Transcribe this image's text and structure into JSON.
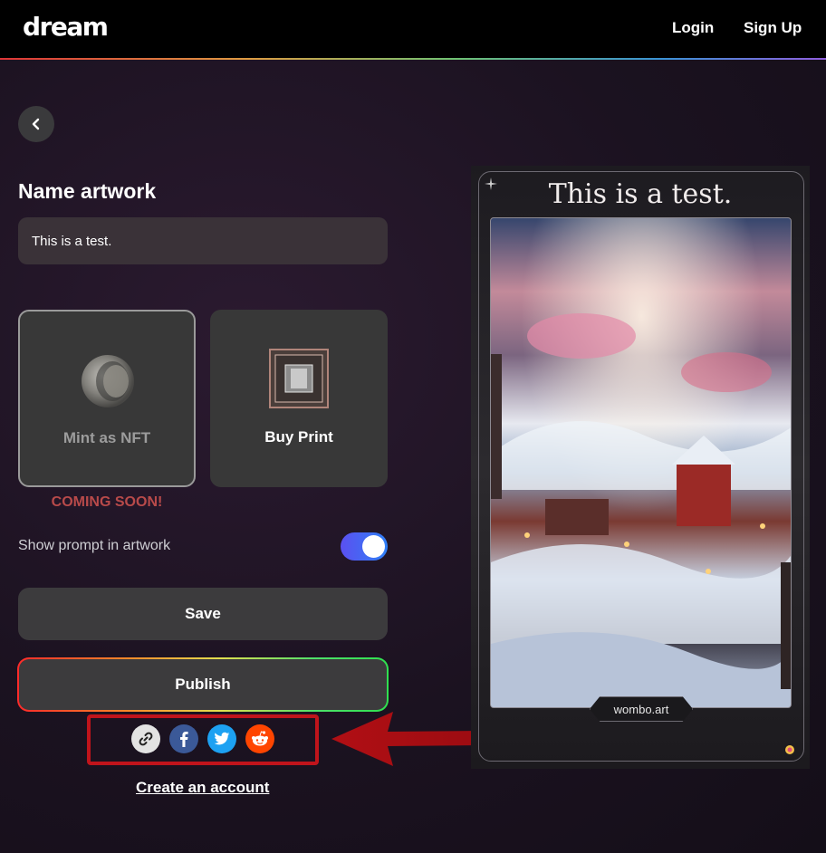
{
  "header": {
    "logo": "dream",
    "login_label": "Login",
    "signup_label": "Sign Up"
  },
  "form": {
    "title": "Name artwork",
    "name_value": "This is a test.",
    "options": [
      {
        "label": "Mint as NFT",
        "status": "COMING SOON!"
      },
      {
        "label": "Buy Print"
      }
    ],
    "show_prompt_label": "Show prompt in artwork",
    "show_prompt_enabled": true,
    "save_label": "Save",
    "publish_label": "Publish",
    "share_icons": [
      "link-icon",
      "facebook-icon",
      "twitter-icon",
      "reddit-icon"
    ],
    "create_account_label": "Create an account"
  },
  "preview": {
    "title": "This is a test.",
    "tag": "wombo.art"
  },
  "colors": {
    "toggle": "#3f6cf5",
    "facebook": "#3b5998",
    "twitter": "#1da1f2",
    "reddit": "#ff4500",
    "highlight": "#c0141b"
  }
}
